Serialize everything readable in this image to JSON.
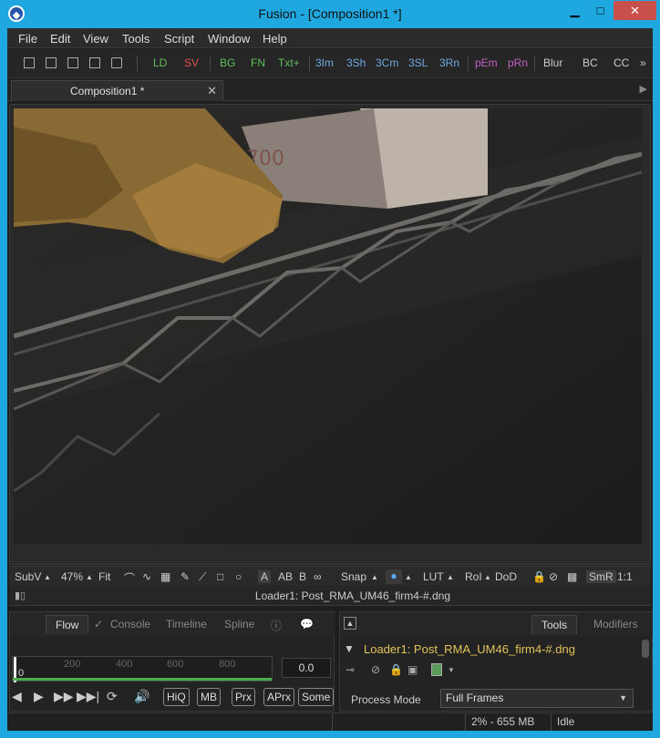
{
  "window": {
    "title": "Fusion - [Composition1 *]",
    "icon": "fusion-logo-icon",
    "accent": "#1fa8e0",
    "close_color": "#c7504b"
  },
  "menu": [
    "File",
    "Edit",
    "View",
    "Tools",
    "Script",
    "Window",
    "Help"
  ],
  "toolbar": {
    "buttons": [
      {
        "label": "LD",
        "color": "#5fbf5f"
      },
      {
        "label": "SV",
        "color": "#e05050"
      },
      {
        "label": "BG",
        "color": "#5fbf5f"
      },
      {
        "label": "FN",
        "color": "#5fbf5f"
      },
      {
        "label": "Txt+",
        "color": "#5fbf5f"
      },
      {
        "label": "3Im",
        "color": "#6fa8e0"
      },
      {
        "label": "3Sh",
        "color": "#6fa8e0"
      },
      {
        "label": "3Cm",
        "color": "#6fa8e0"
      },
      {
        "label": "3SL",
        "color": "#6fa8e0"
      },
      {
        "label": "3Rn",
        "color": "#6fa8e0"
      },
      {
        "label": "pEm",
        "color": "#c060c0"
      },
      {
        "label": "pRn",
        "color": "#c060c0"
      },
      {
        "label": "Blur",
        "color": "#cccccc"
      },
      {
        "label": "BC",
        "color": "#cccccc"
      },
      {
        "label": "CC",
        "color": "#cccccc"
      }
    ],
    "overflow": "»"
  },
  "tabs": [
    {
      "label": "Composition1 *"
    }
  ],
  "viewer": {
    "bar": {
      "subview": "SubV",
      "zoom": "47%",
      "fit": "Fit",
      "text_a": "A",
      "text_ab": "AB",
      "text_b": "B",
      "snap": "Snap",
      "lut": "LUT",
      "roi": "RoI",
      "dod": "DoD",
      "smr": "SmR",
      "ratio": "1:1"
    },
    "status": "Loader1: Post_RMA_UM46_firm4-#.dng"
  },
  "lower_left": {
    "tabs": [
      "Flow",
      "Console",
      "Timeline",
      "Spline"
    ],
    "active_tab": "Flow",
    "timeline": {
      "ticks": [
        "200",
        "400",
        "600",
        "800"
      ],
      "start": "0",
      "current": "0.0"
    },
    "transport": {
      "buttons": [
        "HiQ",
        "MB",
        "Prx",
        "APrx",
        "Some"
      ]
    }
  },
  "lower_right": {
    "tabs": [
      "Tools",
      "Modifiers"
    ],
    "active_tab": "Tools",
    "node_title": "Loader1: Post_RMA_UM46_firm4-#.dng",
    "process_mode_label": "Process Mode",
    "process_mode_value": "Full Frames"
  },
  "statusbar": {
    "memory": "2% -  655 MB",
    "state": "Idle"
  }
}
